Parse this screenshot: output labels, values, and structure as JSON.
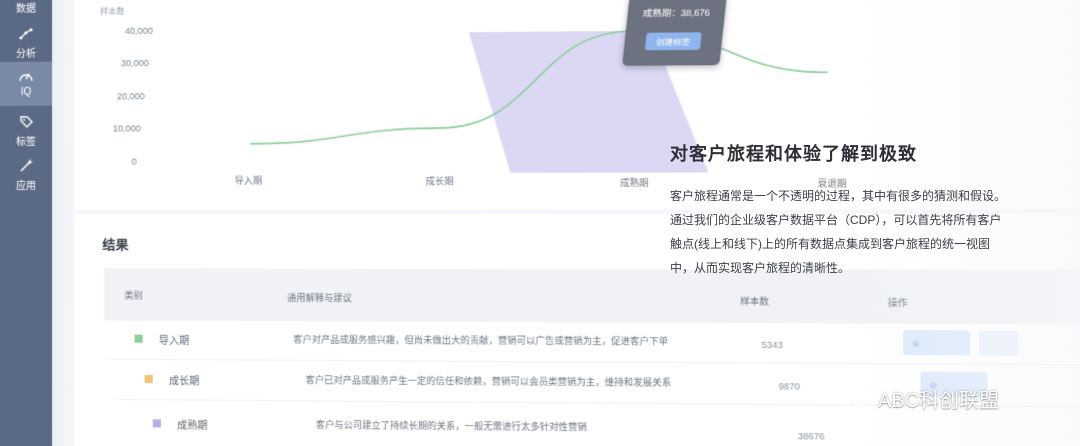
{
  "sidebar": {
    "items": [
      {
        "label": "数据",
        "icon": "database-icon"
      },
      {
        "label": "分析",
        "icon": "scatter-icon"
      },
      {
        "label": "IQ",
        "icon": "gauge-icon",
        "active": true
      },
      {
        "label": "标签",
        "icon": "tag-icon"
      },
      {
        "label": "应用",
        "icon": "wand-icon"
      }
    ]
  },
  "chart": {
    "ylabel": "样本数",
    "tooltip": {
      "text": "成熟期：38,676",
      "button": "创建标签"
    }
  },
  "chart_data": {
    "type": "line",
    "ylabel": "样本数",
    "ylim": [
      0,
      40000
    ],
    "y_ticks": [
      "40,000",
      "30,000",
      "20,000",
      "10,000",
      "0"
    ],
    "categories": [
      "导入期",
      "成长期",
      "成熟期",
      "衰退期"
    ],
    "series": [
      {
        "values": [
          5343,
          9870,
          38676,
          26000
        ],
        "color": "#8ccf9a"
      }
    ],
    "highlight_category": "成熟期",
    "highlight_color": "#d6d1f2",
    "grid": false
  },
  "overlay": {
    "title": "对客户旅程和体验了解到极致",
    "lines": [
      "客户旅程通常是一个不透明的过程，其中有很多的猜测和假设。",
      "通过我们的企业级客户数据平台（CDP），可以首先将所有客户",
      "触点(线上和线下)上的所有数据点集成到客户旅程的统一视图",
      "中，从而实现客户旅程的清晰性。"
    ]
  },
  "results": {
    "title": "结果",
    "headers": [
      "类别",
      "通用解释与建议",
      "样本数",
      "操作"
    ],
    "rows": [
      {
        "name": "导入期",
        "color": "#8ccf9a",
        "desc": "客户对产品或服务感兴趣，但尚未做出大的贡献，营销可以广告或营销为主，促进客户下单",
        "count": "5343"
      },
      {
        "name": "成长期",
        "color": "#f2c27a",
        "desc": "客户已对产品或服务产生一定的信任和依赖，营销可以会员类营销为主，维持和发展关系",
        "count": "9870"
      },
      {
        "name": "成熟期",
        "color": "#b9aee6",
        "desc": "客户与公司建立了持续长期的关系，一般无需进行太多针对性营销",
        "count": "38676"
      }
    ],
    "action_label": "创建标签"
  },
  "watermark": {
    "text": "ABC科创联盟"
  }
}
